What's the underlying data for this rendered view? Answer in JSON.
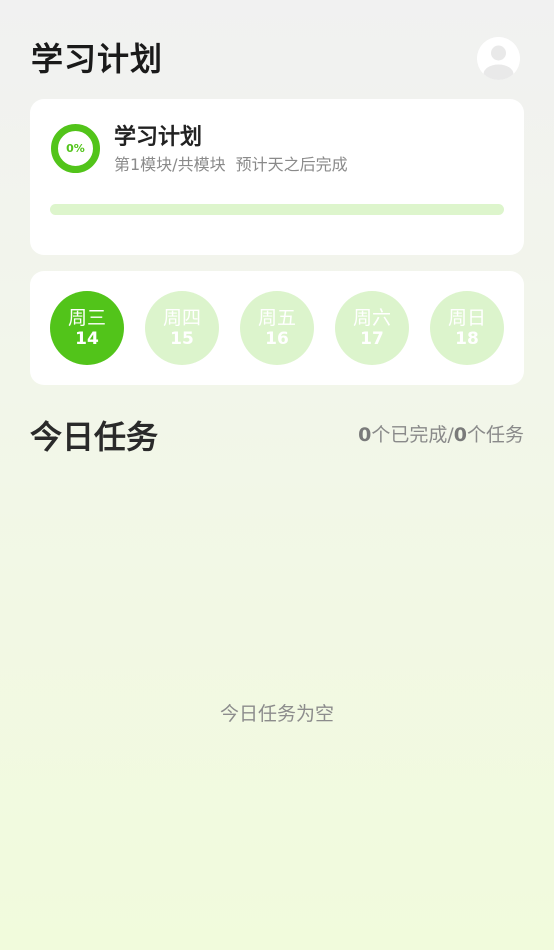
{
  "header": {
    "title": "学习计划"
  },
  "plan": {
    "ring_label": "0%",
    "progress_fraction": 0,
    "name": "学习计划",
    "module_text": "第1模块/共模块",
    "eta_text": "预计天之后完成"
  },
  "days": [
    {
      "weekday": "周三",
      "date": "14",
      "active": true
    },
    {
      "weekday": "周四",
      "date": "15",
      "active": false
    },
    {
      "weekday": "周五",
      "date": "16",
      "active": false
    },
    {
      "weekday": "周六",
      "date": "17",
      "active": false
    },
    {
      "weekday": "周日",
      "date": "18",
      "active": false
    }
  ],
  "tasks": {
    "title": "今日任务",
    "completed": "0",
    "completed_suffix": "个已完成/",
    "total": "0",
    "total_suffix": "个任务",
    "empty_text": "今日任务为空"
  },
  "colors": {
    "accent": "#52c41a",
    "accent_light": "#dcf4cc"
  }
}
